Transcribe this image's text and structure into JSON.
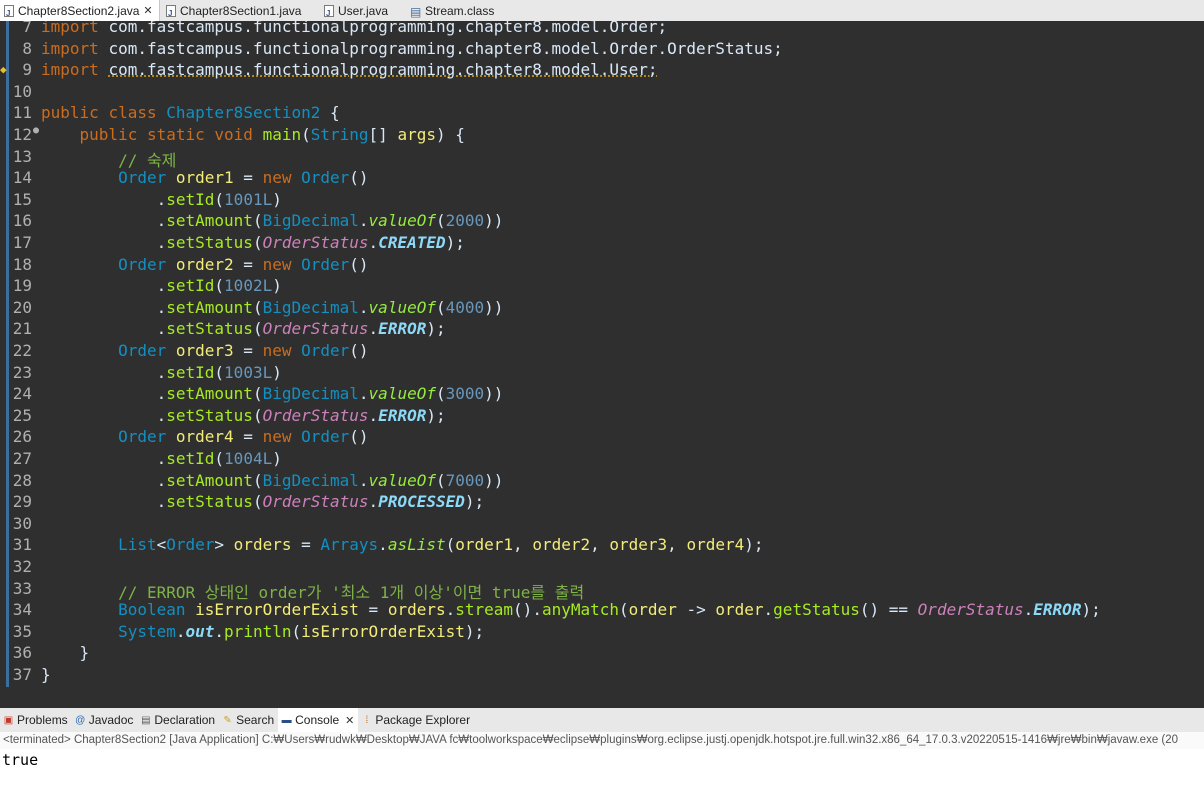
{
  "editor_tabs": [
    {
      "label": "Chapter8Section2.java",
      "active": true,
      "closable": true,
      "icon": "java-file-icon"
    },
    {
      "label": "Chapter8Section1.java",
      "active": false,
      "icon": "java-file-icon"
    },
    {
      "label": "User.java",
      "active": false,
      "icon": "java-file-icon"
    },
    {
      "label": "Stream.class",
      "active": false,
      "icon": "class-file-icon"
    }
  ],
  "editor": {
    "lines": [
      {
        "n": "7",
        "code": "import com.fastcampus.functionalprogramming.chapter8.model.Order;"
      },
      {
        "n": "8",
        "code": "import com.fastcampus.functionalprogramming.chapter8.model.Order.OrderStatus;"
      },
      {
        "n": "9",
        "code": "import com.fastcampus.functionalprogramming.chapter8.model.User;"
      },
      {
        "n": "10",
        "code": ""
      },
      {
        "n": "11",
        "code": "public class Chapter8Section2 {"
      },
      {
        "n": "12",
        "code": "    public static void main(String[] args) {"
      },
      {
        "n": "13",
        "code": "        // 숙제"
      },
      {
        "n": "14",
        "code": "        Order order1 = new Order()"
      },
      {
        "n": "15",
        "code": "            .setId(1001L)"
      },
      {
        "n": "16",
        "code": "            .setAmount(BigDecimal.valueOf(2000))"
      },
      {
        "n": "17",
        "code": "            .setStatus(OrderStatus.CREATED);"
      },
      {
        "n": "18",
        "code": "        Order order2 = new Order()"
      },
      {
        "n": "19",
        "code": "            .setId(1002L)"
      },
      {
        "n": "20",
        "code": "            .setAmount(BigDecimal.valueOf(4000))"
      },
      {
        "n": "21",
        "code": "            .setStatus(OrderStatus.ERROR);"
      },
      {
        "n": "22",
        "code": "        Order order3 = new Order()"
      },
      {
        "n": "23",
        "code": "            .setId(1003L)"
      },
      {
        "n": "24",
        "code": "            .setAmount(BigDecimal.valueOf(3000))"
      },
      {
        "n": "25",
        "code": "            .setStatus(OrderStatus.ERROR);"
      },
      {
        "n": "26",
        "code": "        Order order4 = new Order()"
      },
      {
        "n": "27",
        "code": "            .setId(1004L)"
      },
      {
        "n": "28",
        "code": "            .setAmount(BigDecimal.valueOf(7000))"
      },
      {
        "n": "29",
        "code": "            .setStatus(OrderStatus.PROCESSED);"
      },
      {
        "n": "30",
        "code": ""
      },
      {
        "n": "31",
        "code": "        List<Order> orders = Arrays.asList(order1, order2, order3, order4);"
      },
      {
        "n": "32",
        "code": ""
      },
      {
        "n": "33",
        "code": "        // ERROR 상태인 order가 '최소 1개 이상'이면 true를 출력"
      },
      {
        "n": "34",
        "code": "        Boolean isErrorOrderExist = orders.stream().anyMatch(order -> order.getStatus() == OrderStatus.ERROR);"
      },
      {
        "n": "35",
        "code": "        System.out.println(isErrorOrderExist);"
      },
      {
        "n": "36",
        "code": "    }"
      },
      {
        "n": "37",
        "code": "}"
      }
    ],
    "hscroll_left": "<"
  },
  "views_tabs": [
    {
      "label": "Problems",
      "icon": "problems-icon"
    },
    {
      "label": "Javadoc",
      "icon": "javadoc-icon"
    },
    {
      "label": "Declaration",
      "icon": "declaration-icon"
    },
    {
      "label": "Search",
      "icon": "search-icon"
    },
    {
      "label": "Console",
      "icon": "console-icon",
      "active": true,
      "closable": true
    },
    {
      "label": "Package Explorer",
      "icon": "package-explorer-icon"
    }
  ],
  "console": {
    "status": "<terminated> Chapter8Section2 [Java Application] C:₩Users₩rudwk₩Desktop₩JAVA fc₩toolworkspace₩eclipse₩plugins₩org.eclipse.justj.openjdk.hotspot.jre.full.win32.x86_64_17.0.3.v20220515-1416₩jre₩bin₩javaw.exe  (20",
    "output": "true"
  },
  "colors": {
    "editor_bg": "#2f2f2f",
    "keyword": "#cc6c1d",
    "class_name": "#1290c3",
    "variable": "#f3ec79",
    "number": "#6897bb",
    "method": "#a7ec21",
    "comment": "#7fb347"
  }
}
